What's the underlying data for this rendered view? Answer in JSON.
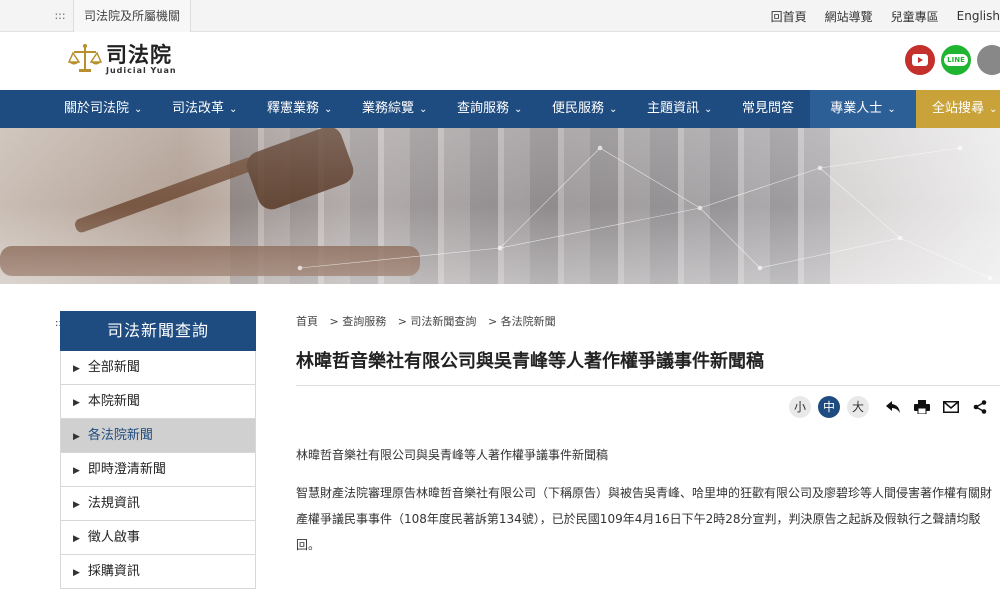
{
  "topbar": {
    "agency_label": "司法院及所屬機關",
    "links": [
      "回首頁",
      "網站導覽",
      "兒童專區",
      "English"
    ]
  },
  "header": {
    "logo_zh": "司法院",
    "logo_en": "Judicial Yuan",
    "social_icons": [
      "youtube-icon",
      "line-icon",
      "more-icon"
    ],
    "line_label": "LINE"
  },
  "nav": {
    "items": [
      "關於司法院",
      "司法改革",
      "釋憲業務",
      "業務綜覽",
      "查詢服務",
      "便民服務",
      "主題資訊",
      "常見問答",
      "專業人士",
      "全站搜尋"
    ]
  },
  "sidebar": {
    "title": "司法新聞查詢",
    "items": [
      "全部新聞",
      "本院新聞",
      "各法院新聞",
      "即時澄清新聞",
      "法規資訊",
      "徵人啟事",
      "採購資訊"
    ],
    "active_index": 2
  },
  "breadcrumb": [
    "首頁",
    "> 查詢服務",
    "> 司法新聞查詢",
    "> 各法院新聞"
  ],
  "article": {
    "title": "林暐哲音樂社有限公司與吳青峰等人著作權爭議事件新聞稿",
    "font_sizes": [
      "小",
      "中",
      "大"
    ],
    "selected_font_size": "中",
    "tool_icons": [
      "back-icon",
      "print-icon",
      "mail-icon",
      "share-icon"
    ],
    "paragraph_1": "林暐哲音樂社有限公司與吳青峰等人著作權爭議事件新聞稿",
    "paragraph_2": "智慧財產法院審理原告林暐哲音樂社有限公司（下稱原告）與被告吳青峰、哈里坤的狂歡有限公司及廖碧珍等人間侵害著作權有關財產權爭議民事事件（108年度民著訴第134號），已於民國109年4月16日下午2時28分宣判，判決原告之起訴及假執行之聲請均駁回。"
  },
  "colors": {
    "nav_bg": "#1f4c80",
    "search_bg": "#c9a33a",
    "pro_bg": "#2d5f97"
  }
}
